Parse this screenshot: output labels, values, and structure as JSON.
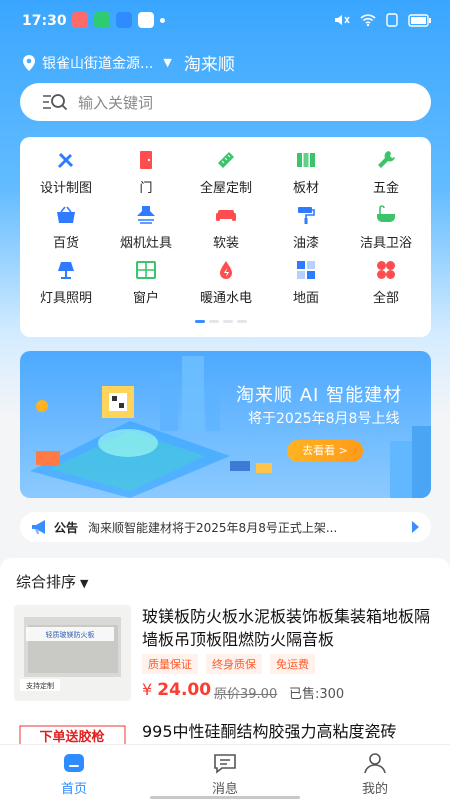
{
  "status_bar": {
    "time": "17:30"
  },
  "location": {
    "text": "银雀山街道金源...",
    "brand": "淘来顺"
  },
  "search": {
    "placeholder": "输入关键词"
  },
  "categories": [
    {
      "label": "设计制图",
      "icon": "ruler-pencil-icon",
      "color": "#2f7bff"
    },
    {
      "label": "门",
      "icon": "door-icon",
      "color": "#ff4d4f"
    },
    {
      "label": "全屋定制",
      "icon": "tape-measure-icon",
      "color": "#3cc46b"
    },
    {
      "label": "板材",
      "icon": "panels-icon",
      "color": "#3cc46b"
    },
    {
      "label": "五金",
      "icon": "wrench-icon",
      "color": "#3cc46b"
    },
    {
      "label": "百货",
      "icon": "basket-icon",
      "color": "#2f7bff"
    },
    {
      "label": "烟机灶具",
      "icon": "range-hood-icon",
      "color": "#2f7bff"
    },
    {
      "label": "软装",
      "icon": "sofa-icon",
      "color": "#ff4d4f"
    },
    {
      "label": "油漆",
      "icon": "paint-roller-icon",
      "color": "#2f7bff"
    },
    {
      "label": "洁具卫浴",
      "icon": "bathtub-icon",
      "color": "#3cc46b"
    },
    {
      "label": "灯具照明",
      "icon": "lamp-icon",
      "color": "#2f7bff"
    },
    {
      "label": "窗户",
      "icon": "window-icon",
      "color": "#3cc46b"
    },
    {
      "label": "暖通水电",
      "icon": "power-drop-icon",
      "color": "#ff4d4f"
    },
    {
      "label": "地面",
      "icon": "floor-tiles-icon",
      "color": "#2f7bff"
    },
    {
      "label": "全部",
      "icon": "all-grid-icon",
      "color": "#ff4d4f"
    }
  ],
  "banner": {
    "title": "淘来顺 AI 智能建材",
    "subtitle": "将于2025年8月8号上线",
    "button": "去看看 >"
  },
  "notice": {
    "tag": "公告",
    "text": "淘来顺智能建材将于2025年8月8号正式上架..."
  },
  "sort": {
    "label": "综合排序"
  },
  "products": [
    {
      "title": "玻镁板防火板水泥板装饰板集装箱地板隔墙板吊顶板阻燃防火隔音板",
      "tags": [
        "质量保证",
        "终身质保",
        "免运费"
      ],
      "price_symbol": "¥",
      "price": "24.00",
      "original": "原价39.00",
      "sold": "已售:300",
      "thumb_text": "轻质玻镁防火板",
      "thumb_badge": "支持定制"
    },
    {
      "title": "995中性硅酮结构胶强力高粘度瓷砖",
      "tags": [],
      "thumb_text": "下单送胶枪"
    }
  ],
  "tabbar": [
    {
      "label": "首页",
      "icon": "home-icon",
      "active": true
    },
    {
      "label": "消息",
      "icon": "message-icon",
      "active": false
    },
    {
      "label": "我的",
      "icon": "profile-icon",
      "active": false
    }
  ],
  "colors": {
    "primary": "#2f8cff",
    "price": "#ff3b30",
    "tag": "#ff5a2a"
  }
}
